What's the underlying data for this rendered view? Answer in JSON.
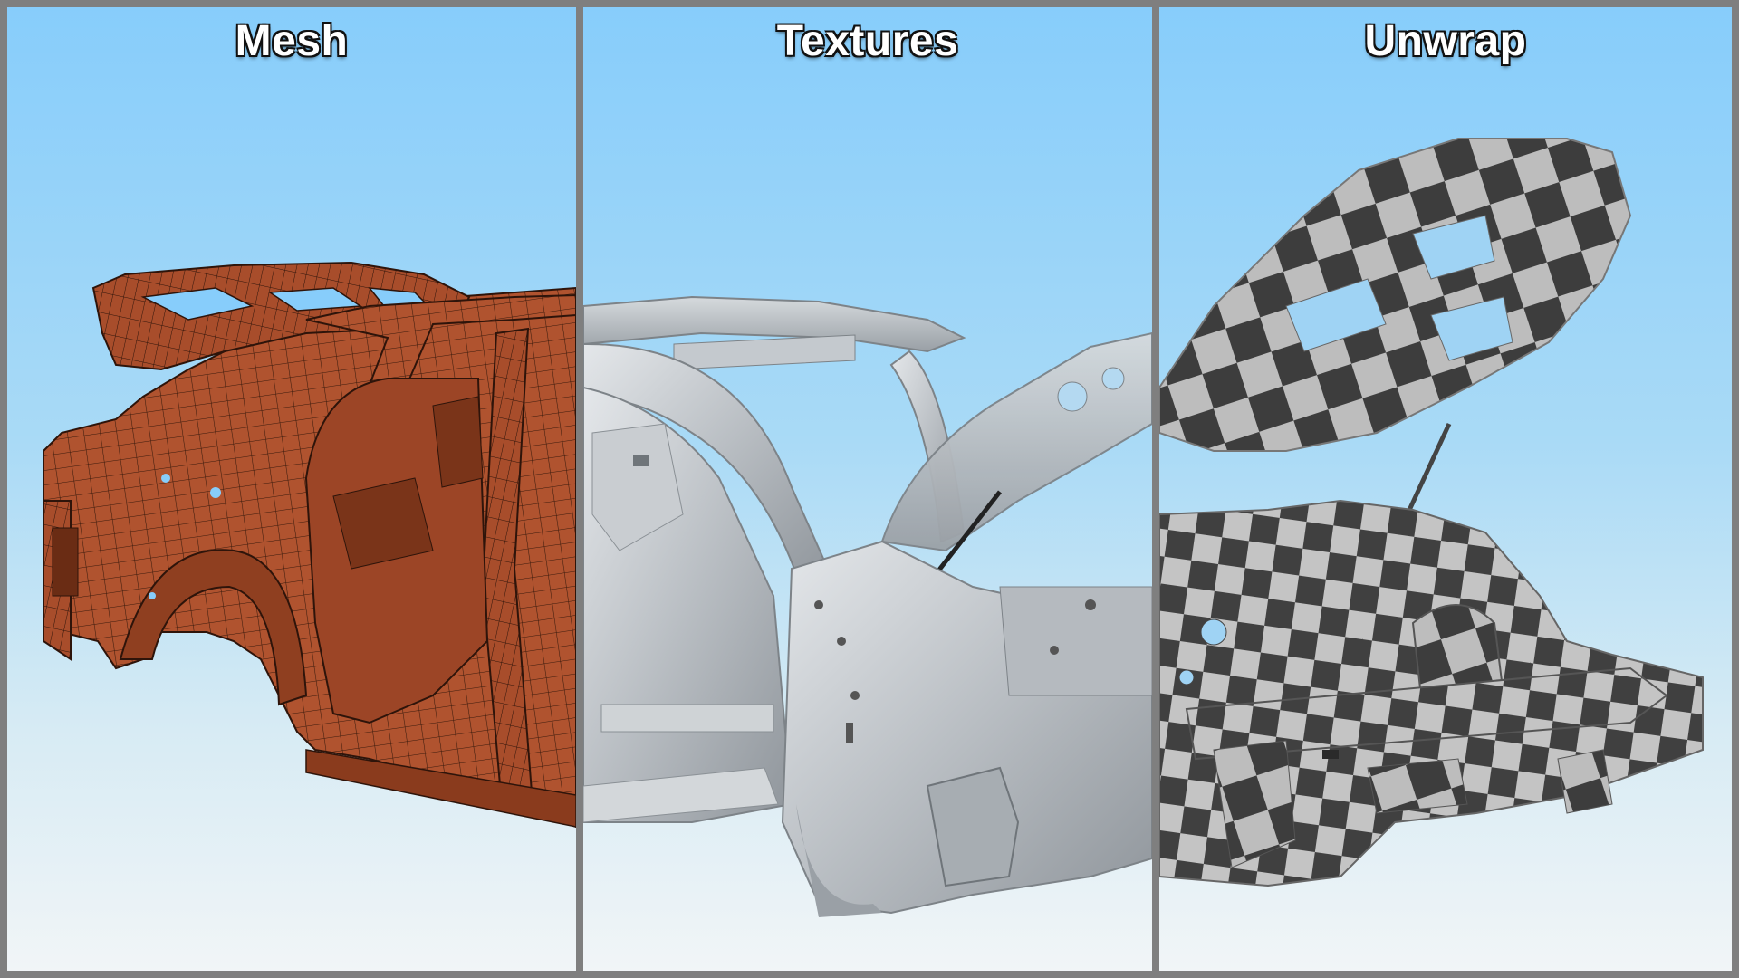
{
  "panels": [
    {
      "title": "Mesh"
    },
    {
      "title": "Textures"
    },
    {
      "title": "Unwrap"
    }
  ],
  "colors": {
    "frame": "#7f7f7f",
    "sky_top": "#87cdfb",
    "sky_bottom": "#f1f5f7",
    "mesh_body": "#b0532f",
    "mesh_wire": "#3a1a0c",
    "metal": "#c9cdd1",
    "checker_dark": "#3d3d3d",
    "checker_light": "#bdbdbd"
  }
}
